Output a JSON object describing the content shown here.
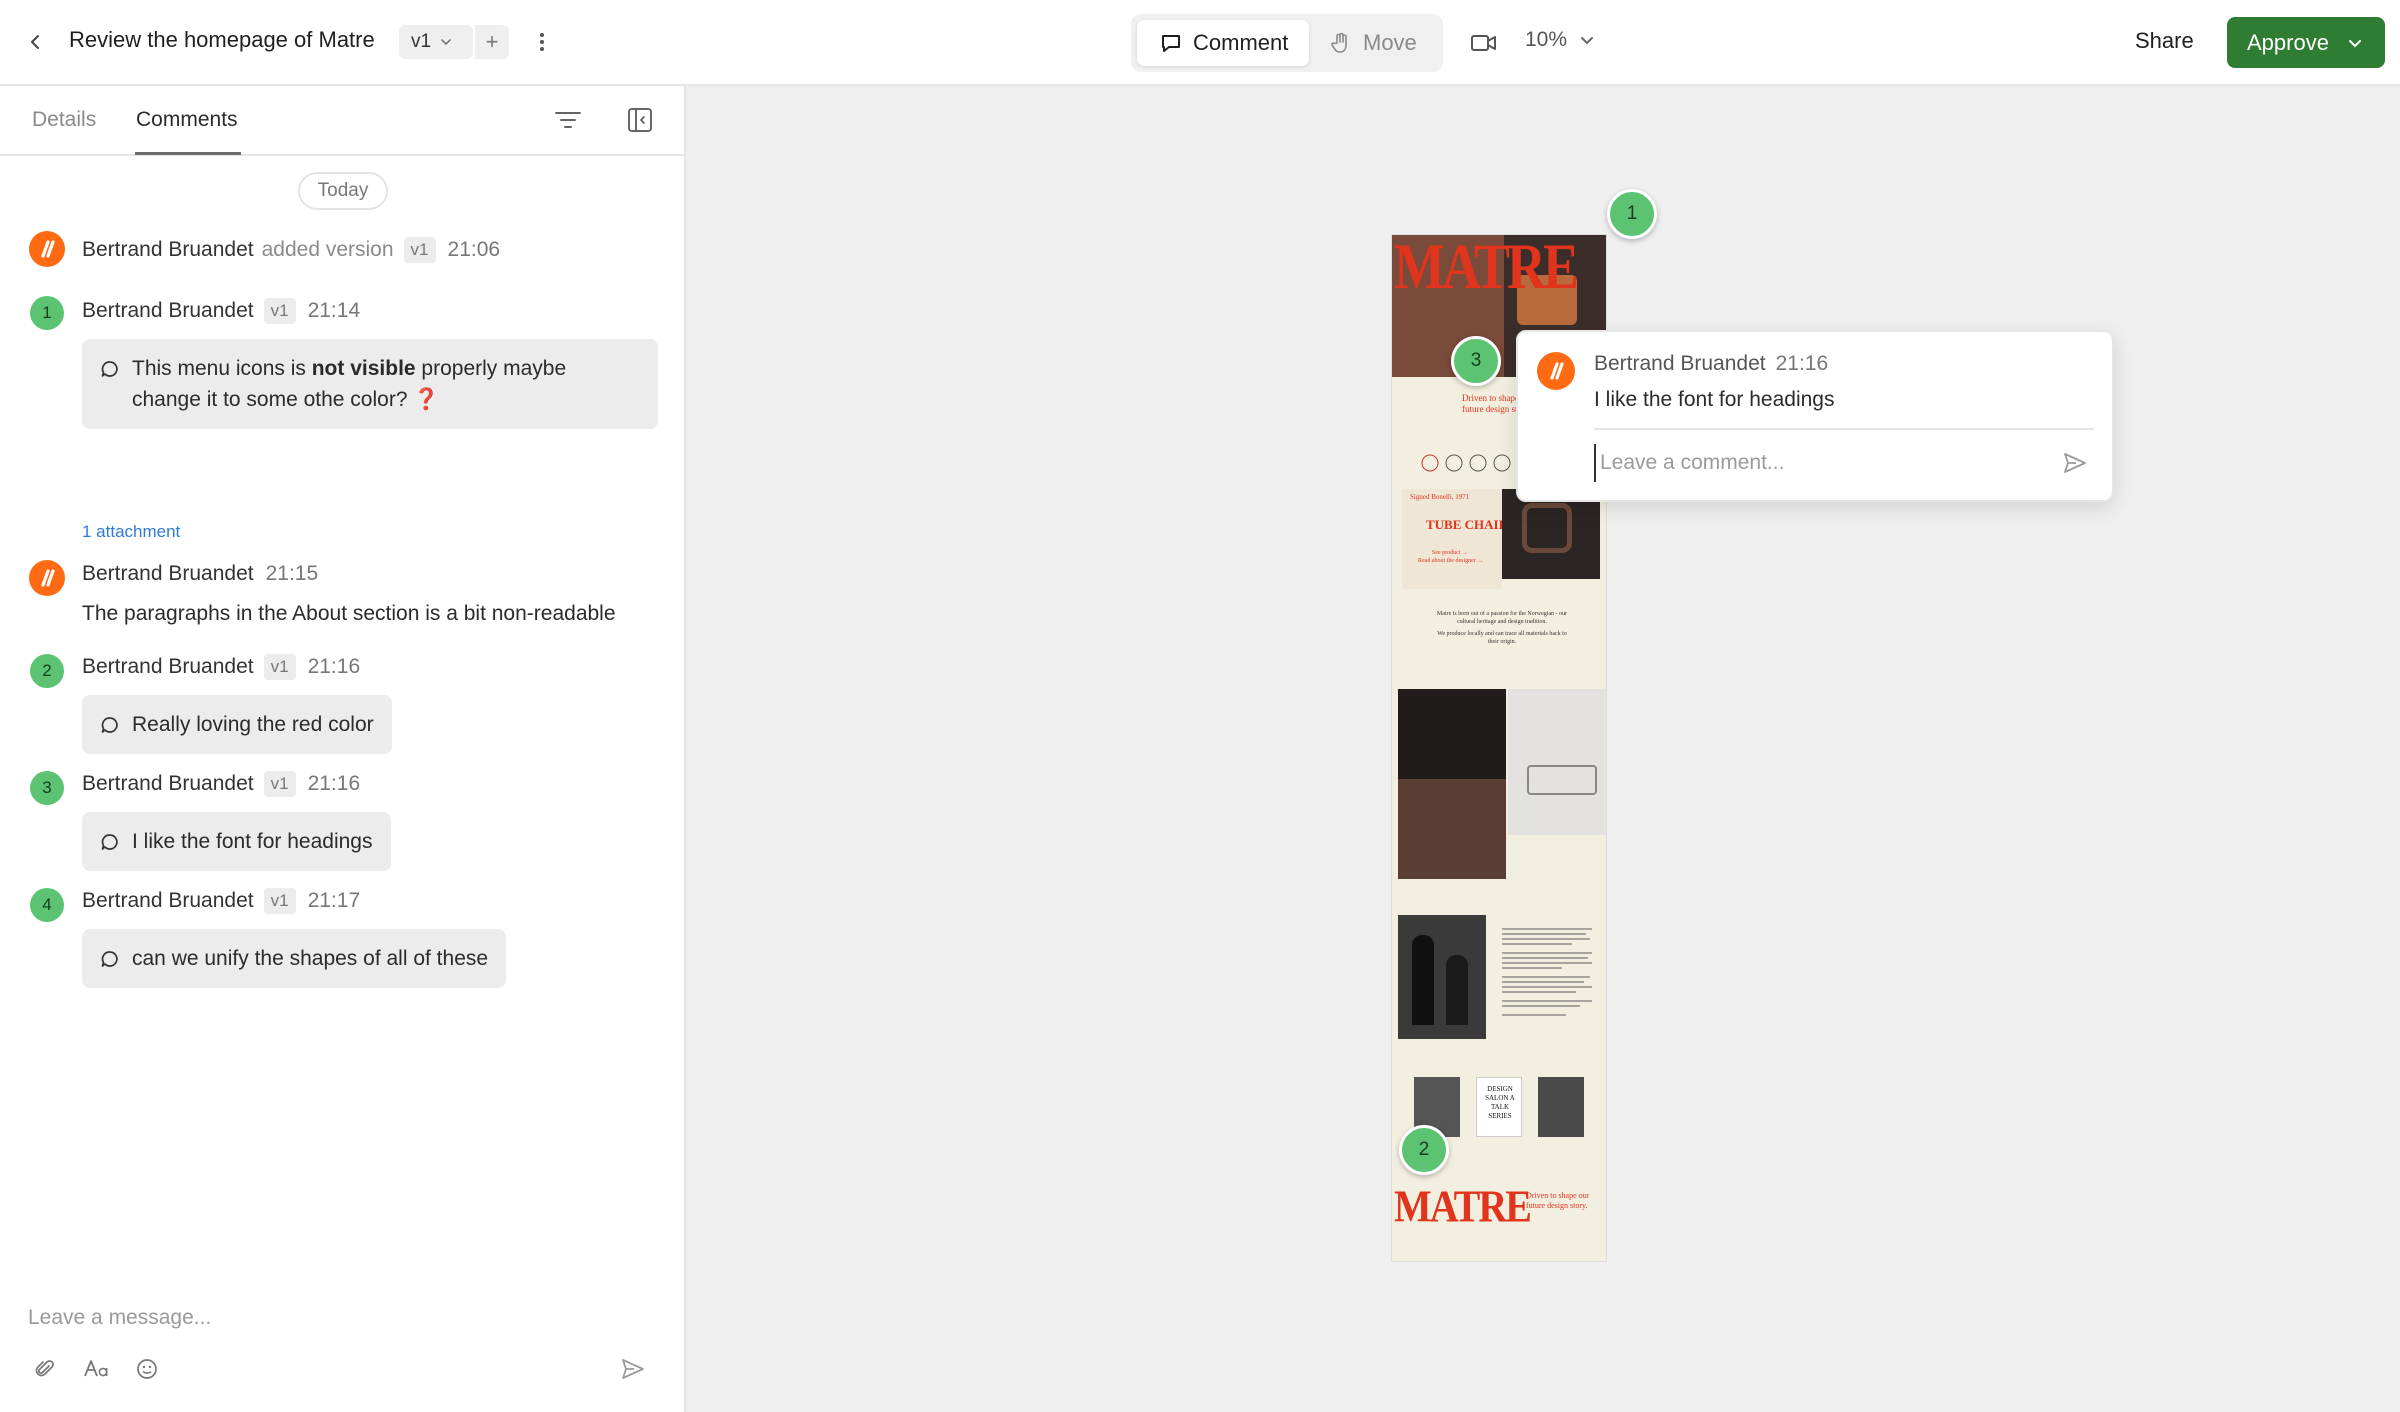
{
  "header": {
    "title": "Review the homepage of Matre",
    "version": "v1",
    "add_label": "+",
    "comment_mode": "Comment",
    "move_mode": "Move",
    "zoom": "10%",
    "share": "Share",
    "approve": "Approve"
  },
  "sidebar": {
    "tabs": [
      "Details",
      "Comments"
    ],
    "active_tab": "Comments",
    "date_label": "Today",
    "message_placeholder": "Leave a message..."
  },
  "activity": {
    "author": "Bertrand Bruandet",
    "action": "added version",
    "version": "v1",
    "time": "21:06"
  },
  "comments": [
    {
      "number": "1",
      "author": "Bertrand Bruandet",
      "version": "v1",
      "time": "21:14",
      "text_before": "This menu icons is ",
      "text_bold": "not visible",
      "text_after": " properly maybe",
      "text_line2": "change it to some othe color? ",
      "emoji": "❓",
      "attachment": "1 attachment"
    },
    {
      "author": "Bertrand Bruandet",
      "time": "21:15",
      "text": "The paragraphs in the About section is a bit non-readable"
    },
    {
      "number": "2",
      "author": "Bertrand Bruandet",
      "version": "v1",
      "time": "21:16",
      "text": "Really loving the red color"
    },
    {
      "number": "3",
      "author": "Bertrand Bruandet",
      "version": "v1",
      "time": "21:16",
      "text": "I like the font for headings"
    },
    {
      "number": "4",
      "author": "Bertrand Bruandet",
      "version": "v1",
      "time": "21:17",
      "text": "can we unify the shapes of all of these"
    }
  ],
  "canvas": {
    "pins": [
      "1",
      "3",
      "2"
    ],
    "popover": {
      "author": "Bertrand Bruandet",
      "time": "21:16",
      "text": "I like the font for headings",
      "placeholder": "Leave a comment..."
    },
    "thumbnail": {
      "brand": "MATRE",
      "hero_tagline": "Driven to shape our future design story.",
      "product_caption": "Signed Bonelli, 1971",
      "product_name": "TUBE CHAIR",
      "product_link_1": "See product →",
      "product_link_2": "Read about the designer →",
      "about_line_1": "Matre is born out of a passion for the Norwegian - our cultural heritage and design tradition.",
      "about_line_2": "We produce locally and can trace all materials back to their origin.",
      "event_title": "DESIGN SALON A TALK SERIES",
      "footer_tagline": "Driven to shape our future design story."
    }
  },
  "colors": {
    "approve": "#2e7d32",
    "badge": "#5cc372",
    "avatar": "#ff6a13",
    "brand_red": "#e0341c",
    "link": "#2f7bd6"
  },
  "icons": {
    "back": "chevron-left-icon",
    "version_dropdown": "chevron-down-icon",
    "more": "kebab-icon",
    "comment": "speech-bubble-icon",
    "move": "hand-icon",
    "camera": "video-camera-icon",
    "filter": "filter-icon",
    "collapse": "panel-collapse-icon",
    "attach": "paperclip-icon",
    "format": "text-format-icon",
    "emoji": "smiley-icon",
    "send": "send-icon"
  }
}
